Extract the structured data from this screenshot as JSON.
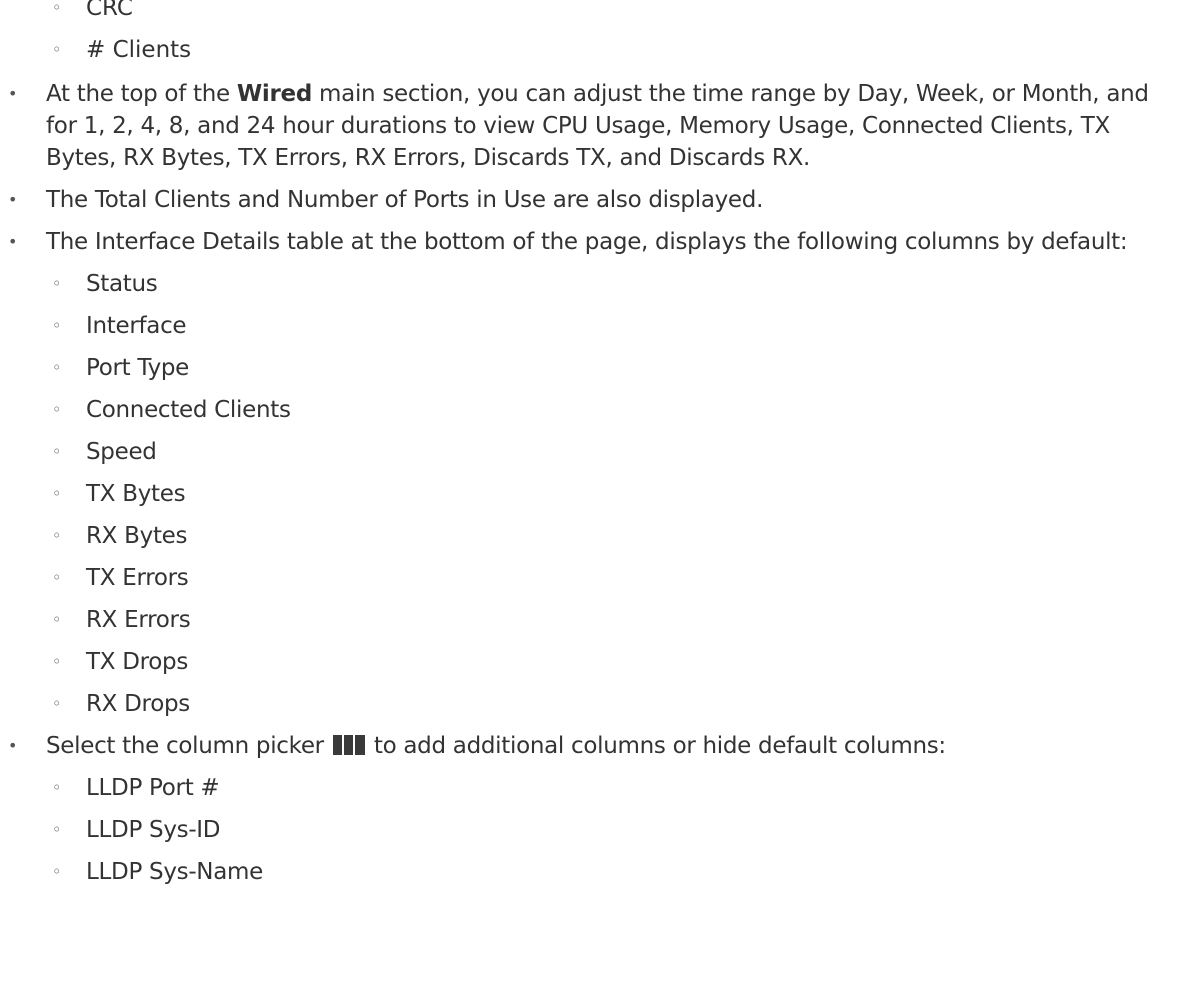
{
  "top_subitems": [
    "CRC",
    "# Clients"
  ],
  "bullets": {
    "time_range": {
      "pre": "At the top of the ",
      "bold": "Wired",
      "post": " main section, you can adjust the time range by Day, Week, or Month, and for 1, 2, 4, 8, and 24 hour durations to view CPU Usage, Memory Usage, Connected Clients, TX Bytes, RX Bytes, TX Errors, RX Errors, Discards TX, and Discards RX."
    },
    "totals": "The Total Clients and Number of Ports in Use are also displayed.",
    "interface_table": {
      "text": "The Interface Details table at the bottom of the page, displays the following columns by default:",
      "items": [
        "Status",
        "Interface",
        "Port Type",
        "Connected Clients",
        "Speed",
        "TX Bytes",
        "RX Bytes",
        "TX Errors",
        "RX Errors",
        "TX Drops",
        "RX Drops"
      ]
    },
    "column_picker": {
      "pre": "Select the column picker ",
      "icon": "column-picker-icon",
      "post": " to add additional columns or hide default columns:",
      "items": [
        "LLDP Port #",
        "LLDP Sys-ID",
        "LLDP Sys-Name"
      ]
    }
  },
  "colors": {
    "text": "#333333",
    "icon": "#3a3a3a"
  }
}
